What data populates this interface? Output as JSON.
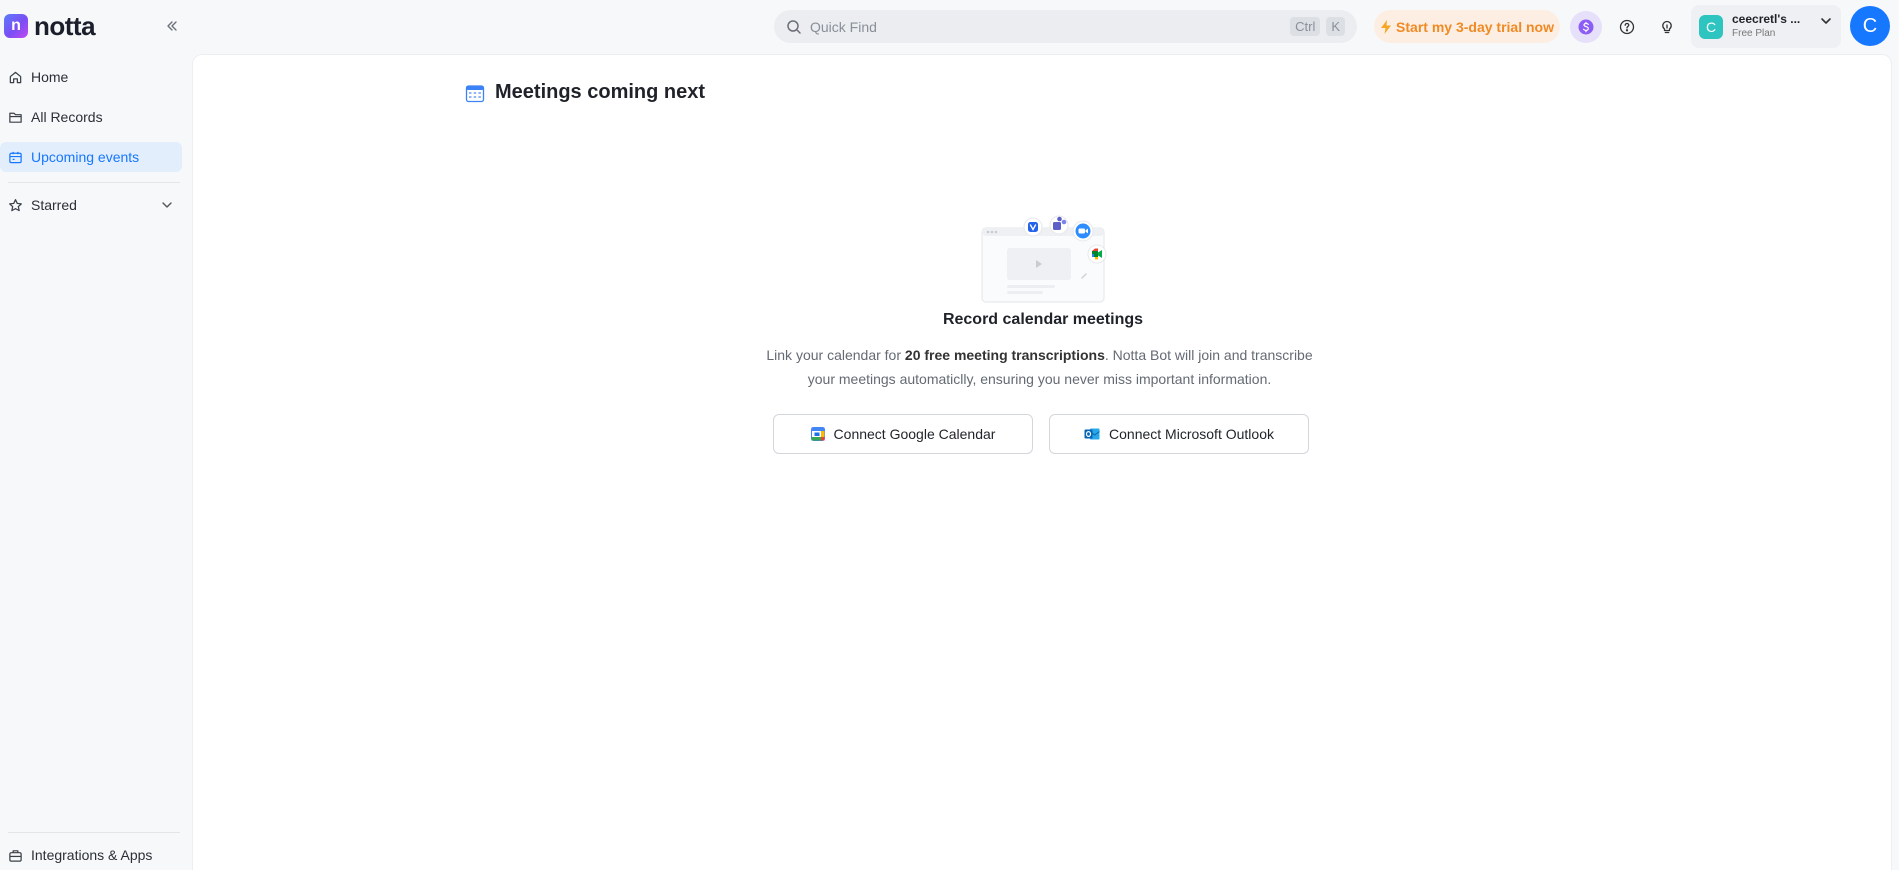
{
  "brand": {
    "logo_letter": "n",
    "name": "notta"
  },
  "search": {
    "placeholder": "Quick Find",
    "shortcut_keys": [
      "Ctrl",
      "K"
    ]
  },
  "header": {
    "trial_label": "Start my 3-day trial now",
    "workspace_name": "ceecretl's ...",
    "workspace_plan": "Free Plan",
    "workspace_initial": "C",
    "user_initial": "C"
  },
  "sidebar": {
    "items": [
      {
        "label": "Home",
        "icon": "home-icon",
        "active": false
      },
      {
        "label": "All Records",
        "icon": "folder-icon",
        "active": false
      },
      {
        "label": "Upcoming events",
        "icon": "calendar-icon",
        "active": true
      }
    ],
    "starred_label": "Starred",
    "bottom_label": "Integrations & Apps"
  },
  "main": {
    "title": "Meetings coming next",
    "empty_title": "Record calendar meetings",
    "desc_prefix": "Link your calendar for ",
    "desc_bold": "20 free meeting transcriptions",
    "desc_suffix": ". Notta Bot will join and transcribe your meetings automaticlly, ensuring you never miss important information.",
    "google_button": "Connect Google Calendar",
    "outlook_button": "Connect Microsoft Outlook"
  },
  "colors": {
    "accent": "#1677ff",
    "trial_text": "#f08a24",
    "trial_bg": "#fdeee3",
    "active_bg": "#e3eefc"
  }
}
